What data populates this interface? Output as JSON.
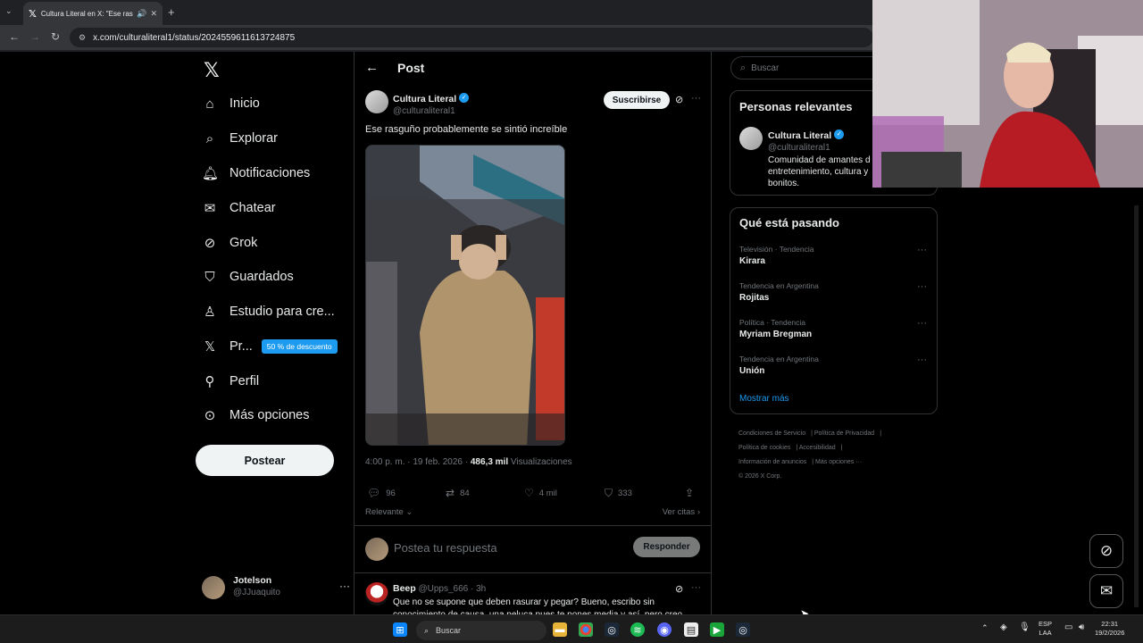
{
  "browser": {
    "tab_title": "Cultura Literal en X: \"Ese rasg",
    "url": "x.com/culturaliteral1/status/2024559611613724875"
  },
  "leftnav": {
    "items": [
      {
        "label": "Inicio",
        "icon": "home-icon"
      },
      {
        "label": "Explorar",
        "icon": "search-icon"
      },
      {
        "label": "Notificaciones",
        "icon": "bell-icon"
      },
      {
        "label": "Chatear",
        "icon": "mail-icon"
      },
      {
        "label": "Grok",
        "icon": "grok-icon"
      },
      {
        "label": "Guardados",
        "icon": "bookmark-icon"
      },
      {
        "label": "Estudio para cre...",
        "icon": "studio-icon"
      },
      {
        "label": "Pr...",
        "icon": "x-premium-icon",
        "badge": "50 % de descuento"
      },
      {
        "label": "Perfil",
        "icon": "person-icon"
      },
      {
        "label": "Más opciones",
        "icon": "more-circle-icon"
      }
    ],
    "post_button": "Postear",
    "user": {
      "name": "Jotelson",
      "handle": "@JJuaquito"
    }
  },
  "post": {
    "header_title": "Post",
    "author": {
      "name": "Cultura Literal",
      "handle": "@culturaliteral1"
    },
    "subscribe_label": "Suscribirse",
    "text": "Ese rasguño probablemente se sintió increíble",
    "timestamp": "4:00 p. m. · 19 feb. 2026 ·",
    "views_count": "486,3 mil",
    "views_label": "Visualizaciones",
    "stats": {
      "replies": "96",
      "reposts": "84",
      "likes": "4 mil",
      "bookmarks": "333"
    },
    "sort_label": "Relevante",
    "quotes_label": "Ver citas",
    "reply_placeholder": "Postea tu respuesta",
    "reply_button": "Responder"
  },
  "reply": {
    "name": "Beep",
    "handle": "@Upps_666",
    "time": "· 3h",
    "text": "Que no se supone que deben rasurar y pegar? Bueno, escribo sin conocimiento de causa, una peluca pues te pones media y así, pero creo"
  },
  "right": {
    "search_placeholder": "Buscar",
    "relevant_title": "Personas relevantes",
    "relevant_person": {
      "name": "Cultura Literal",
      "handle": "@culturaliteral1",
      "bio": "Comunidad de amantes d entretenimiento, cultura y bonitos."
    },
    "trends_title": "Qué está pasando",
    "trends": [
      {
        "category": "Televisión · Tendencia",
        "name": "Kirara"
      },
      {
        "category": "Tendencia en Argentina",
        "name": "Rojitas"
      },
      {
        "category": "Política · Tendencia",
        "name": "Myriam Bregman"
      },
      {
        "category": "Tendencia en Argentina",
        "name": "Unión"
      }
    ],
    "show_more": "Mostrar más",
    "footer_links": [
      "Condiciones de Servicio",
      "Política de Privacidad",
      "Política de cookies",
      "Accesibilidad",
      "Información de anuncios",
      "Más opciones ···",
      "© 2026 X Corp."
    ]
  },
  "taskbar": {
    "search_placeholder": "Buscar",
    "lang1": "ESP",
    "lang2": "LAA",
    "time": "22:31",
    "date": "19/2/2026"
  },
  "colors": {
    "accent": "#1d9bf0",
    "background": "#000000",
    "muted": "#71767b",
    "text": "#e7e9ea"
  }
}
